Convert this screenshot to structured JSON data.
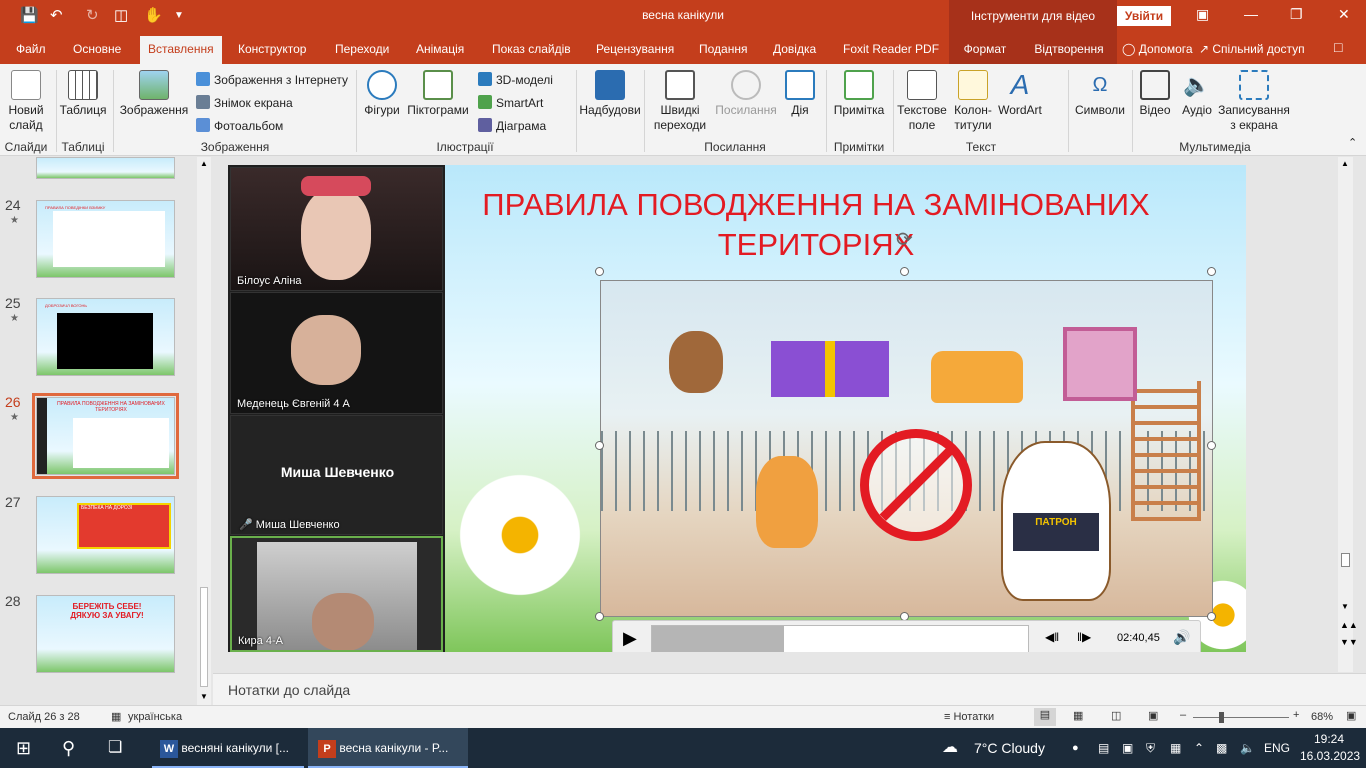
{
  "window": {
    "title": "весна канікули",
    "context_title": "Інструменти для відео",
    "signin": "Увійти"
  },
  "tabs": {
    "file": "Файл",
    "home": "Основне",
    "insert": "Вставлення",
    "design": "Конструктор",
    "transitions": "Переходи",
    "animations": "Анімація",
    "slideshow": "Показ слайдів",
    "review": "Рецензування",
    "view": "Подання",
    "help": "Довідка",
    "foxit": "Foxit Reader PDF",
    "format": "Формат",
    "playback": "Відтворення",
    "tellme": "Допомога",
    "share": "Спільний доступ"
  },
  "ribbon": {
    "new_slide": "Новий слайд",
    "table": "Таблиця",
    "pictures": "Зображення",
    "online_pictures": "Зображення з Інтернету",
    "screenshot": "Знімок екрана",
    "photo_album": "Фотоальбом",
    "shapes": "Фігури",
    "icons": "Піктограми",
    "models3d": "3D-моделі",
    "smartart": "SmartArt",
    "chart": "Діаграма",
    "addins": "Надбудови",
    "zoom": "Швидкі переходи",
    "link": "Посилання",
    "action": "Дія",
    "comment": "Примітка",
    "textbox": "Текстове поле",
    "headerfooter": "Колон-титули",
    "wordart": "WordArt",
    "symbols": "Символи",
    "video": "Відео",
    "audio": "Аудіо",
    "screenrec": "Записування з екрана",
    "groups": {
      "slides": "Слайди",
      "tables": "Таблиці",
      "images": "Зображення",
      "illustrations": "Ілюстрації",
      "links": "Посилання",
      "comments": "Примітки",
      "text": "Текст",
      "media": "Мультимедіа"
    }
  },
  "thumbnails": [
    {
      "num": "24",
      "caption": "ПРАВИЛА ПОВЕДІНКИ ВЗИМКУ"
    },
    {
      "num": "25",
      "caption": "ДОБРОЗИЧЛ ВОГОНЬ"
    },
    {
      "num": "26",
      "caption": "ПРАВИЛА ПОВОДЖЕННЯ НА ЗАМІНОВАНИХ ТЕРИТОРІЯХ"
    },
    {
      "num": "27",
      "caption": "БЕЗПЕКА НА ДОРОЗІ"
    },
    {
      "num": "28",
      "caption": "БЕРЕЖІТЬ СЕБЕ! ДЯКУЮ ЗА УВАГУ!"
    }
  ],
  "slide": {
    "title": "ПРАВИЛА ПОВОДЖЕННЯ НА ЗАМІНОВАНИХ ТЕРИТОРІЯХ",
    "dog_vest": "ПАТРОН"
  },
  "zoom": {
    "participants": [
      "Білоус Аліна",
      "Меденець Євгеній 4 А",
      "Миша Шевченко",
      "Миша Шевченко",
      "Кира 4-А"
    ]
  },
  "player": {
    "time": "02:40,45",
    "progress": 0.35
  },
  "notes": {
    "placeholder": "Нотатки до слайда"
  },
  "status": {
    "slide": "Слайд 26 з 28",
    "language": "українська",
    "notes": "Нотатки",
    "zoom": "68%"
  },
  "taskbar": {
    "word": "весняні канікули [...",
    "ppt": "весна канікули - P...",
    "weather": "7°C  Cloudy",
    "lang": "ENG",
    "time": "19:24",
    "date": "16.03.2023"
  }
}
